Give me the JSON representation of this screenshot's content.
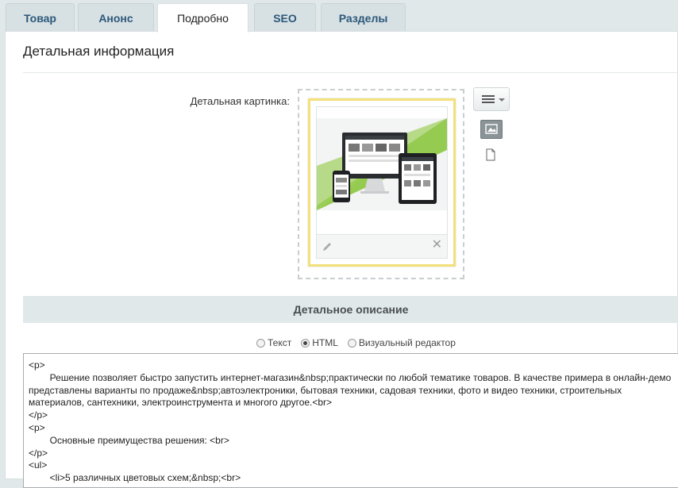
{
  "tabs": [
    {
      "label": "Товар",
      "active": false
    },
    {
      "label": "Анонс",
      "active": false
    },
    {
      "label": "Подробно",
      "active": true
    },
    {
      "label": "SEO",
      "active": false
    },
    {
      "label": "Разделы",
      "active": false
    }
  ],
  "section": {
    "title": "Детальная информация"
  },
  "picture": {
    "label": "Детальная картинка:"
  },
  "description": {
    "header": "Детальное описание",
    "modes": [
      {
        "label": "Текст",
        "selected": false
      },
      {
        "label": "HTML",
        "selected": true
      },
      {
        "label": "Визуальный редактор",
        "selected": false
      }
    ],
    "lines": [
      "<p>",
      "        Решение позволяет быстро запустить интернет-магазин&nbsp;практически по любой тематике товаров. В качестве примера в онлайн-демо представлены варианты по продаже&nbsp;автоэлектроники, бытовая техники, садовая техники, фото и видео техники, строительных материалов, сантехники, электроинструмента и многого другое.<br>",
      "</p>",
      "<p>",
      "        Основные преимущества решения: <br>",
      "</p>",
      "<ul>",
      "        <li>5 различных цветовых схем;&nbsp;<br>"
    ]
  },
  "icons": {
    "menu": "hamburger-menu-icon",
    "image": "image-icon",
    "file": "file-icon",
    "edit": "pencil-icon",
    "delete": "close-icon"
  },
  "colors": {
    "link_blue": "#2b587a",
    "frame_yellow": "#f3e07a",
    "header_bg": "#e1e8ea"
  }
}
